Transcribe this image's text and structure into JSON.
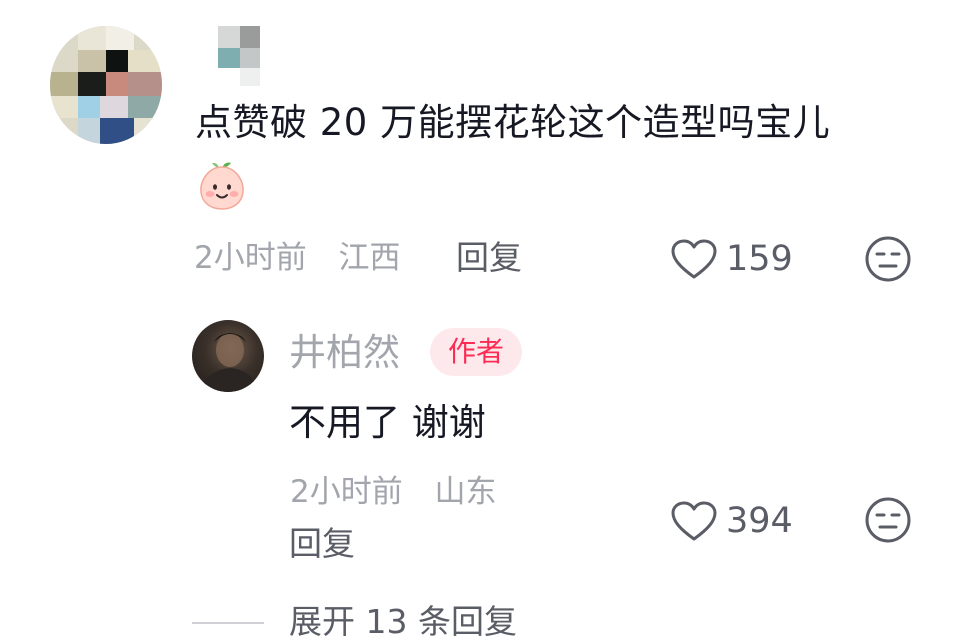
{
  "comment": {
    "text": "点赞破 20 万能摆花轮这个造型吗宝儿",
    "time": "2小时前",
    "location": "江西",
    "reply_label": "回复",
    "like_count": "159",
    "emoji_icon": "smiling-peach-emoji"
  },
  "reply": {
    "author_name": "井柏然",
    "author_badge": "作者",
    "text": "不用了 谢谢",
    "time": "2小时前",
    "location": "山东",
    "reply_label": "回复",
    "like_count": "394"
  },
  "footer": {
    "expand_label": "展开 13 条回复"
  },
  "colors": {
    "text_primary": "#161823",
    "text_muted": "#a3a5ad",
    "text_secondary": "#5a5c66",
    "badge_bg": "#fde8ec",
    "badge_text": "#fe2c55"
  }
}
